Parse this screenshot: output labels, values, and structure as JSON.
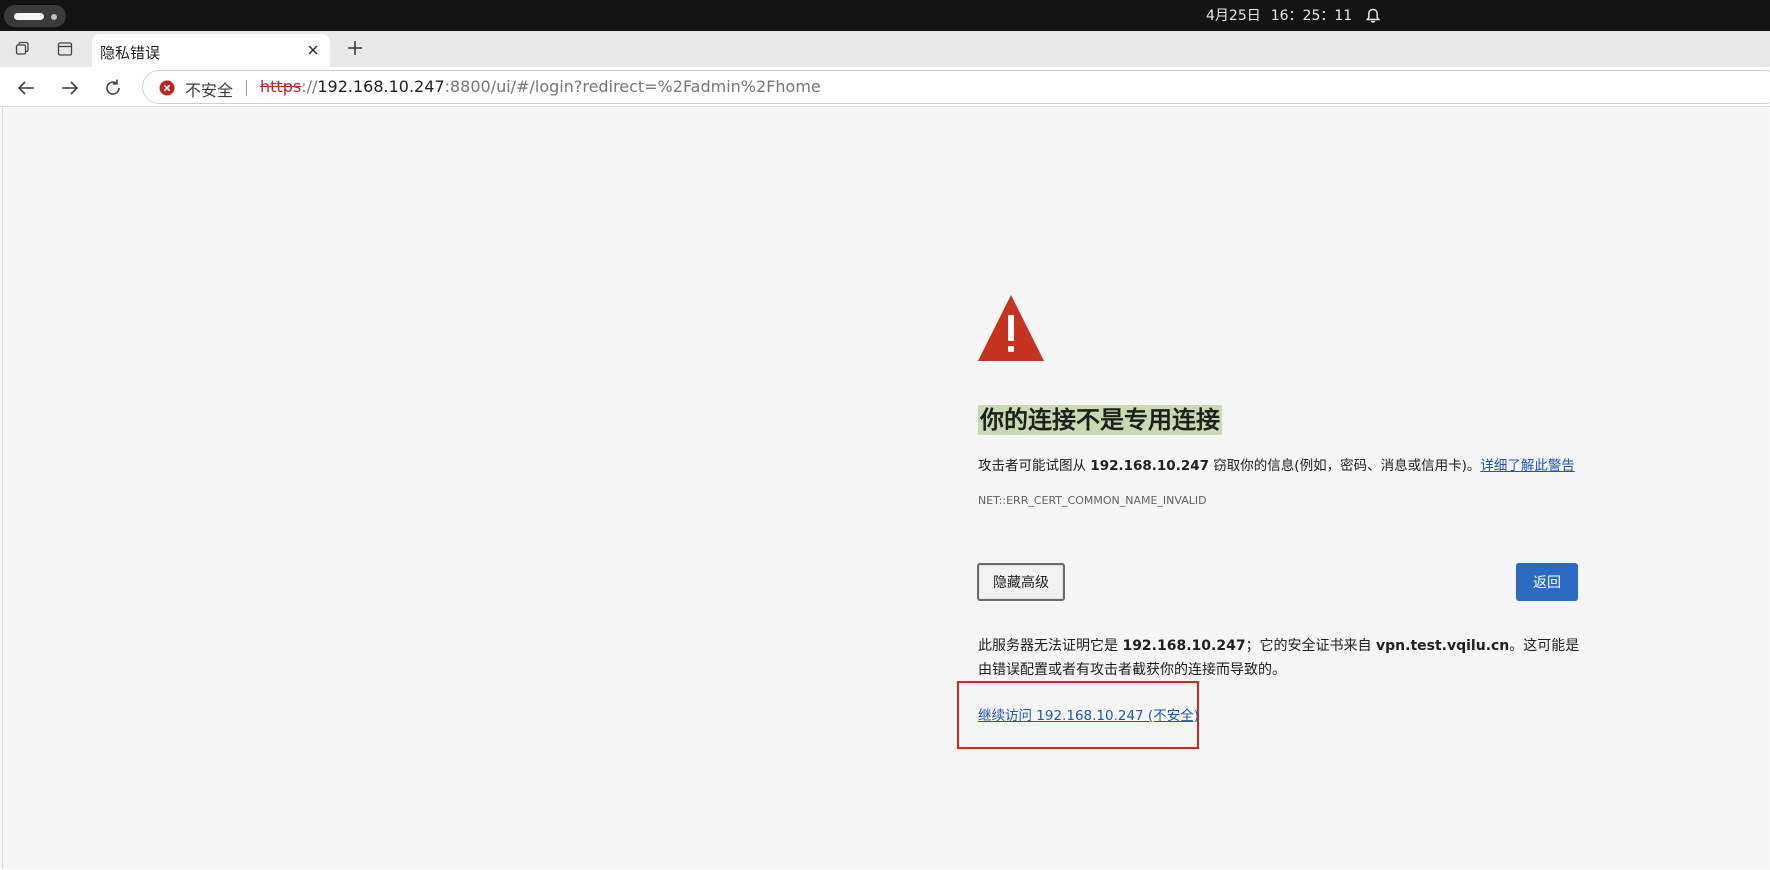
{
  "system_bar": {
    "date": "4月25日",
    "time": "16：25：11"
  },
  "tab": {
    "title": "隐私错误"
  },
  "omnibox": {
    "security_label": "不安全",
    "url_scheme": "https",
    "url_separator": "://",
    "url_host": "192.168.10.247",
    "url_rest": ":8800/ui/#/login?redirect=%2Fadmin%2Fhome"
  },
  "page": {
    "heading": "你的连接不是专用连接",
    "desc_prefix": "攻击者可能试图从 ",
    "desc_host": "192.168.10.247",
    "desc_suffix": " 窃取你的信息(例如，密码、消息或信用卡)。",
    "learn_more_link": "详细了解此警告",
    "error_code": "NET::ERR_CERT_COMMON_NAME_INVALID",
    "hide_advanced_button": "隐藏高级",
    "back_button": "返回",
    "explain_prefix": "此服务器无法证明它是 ",
    "explain_host": "192.168.10.247",
    "explain_mid": "；它的安全证书来自 ",
    "explain_issuer": "vpn.test.vqilu.cn",
    "explain_suffix": "。这可能是由错误配置或者有攻击者截获你的连接而导致的。",
    "proceed_link": "继续访问 192.168.10.247 (不安全)"
  },
  "colors": {
    "warning_red": "#c5321f",
    "link_blue": "#1a56b8",
    "primary_button": "#2b6bc4",
    "highlight_box": "#e0221d",
    "heading_highlight": "#c8dab0"
  }
}
